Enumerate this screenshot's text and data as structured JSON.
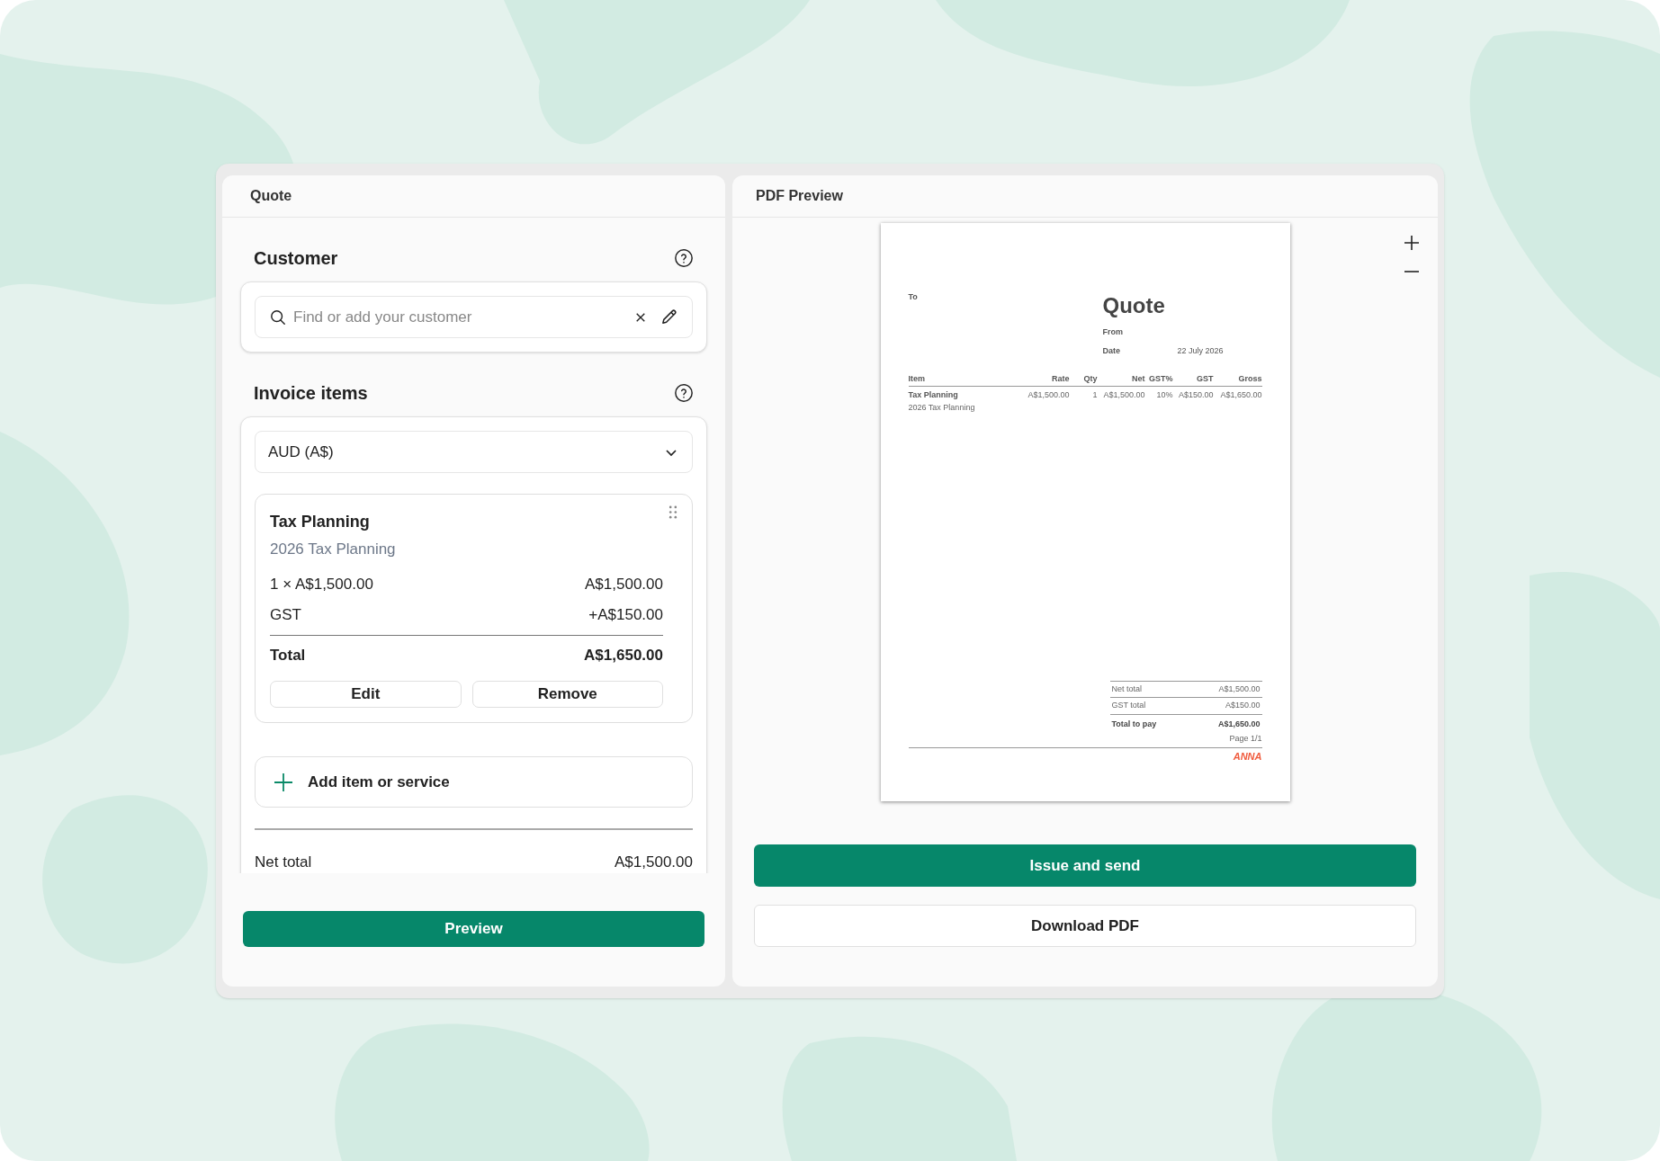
{
  "left_panel": {
    "title": "Quote",
    "customer": {
      "heading": "Customer",
      "search": {
        "placeholder": "Find or add your customer"
      }
    },
    "invoice_items": {
      "heading": "Invoice items",
      "currency": "AUD (A$)",
      "items": [
        {
          "name": "Tax Planning",
          "description": "2026 Tax Planning",
          "quantity_line": "1 × A$1,500.00",
          "net": "A$1,500.00",
          "tax_label": "GST",
          "tax": "+A$150.00",
          "total_label": "Total",
          "total": "A$1,650.00",
          "buttons": [
            "Edit",
            "Remove"
          ]
        }
      ],
      "add_button": "Add item or service",
      "net_total_label": "Net total",
      "net_total": "A$1,500.00"
    },
    "preview_button": "Preview"
  },
  "right_panel": {
    "title": "PDF Preview",
    "document": {
      "to_label": "To",
      "title": "Quote",
      "fields": [
        {
          "label": "From"
        },
        {
          "label": "Date",
          "value": "22 July 2026"
        }
      ],
      "table": {
        "columns": [
          "Item",
          "Rate",
          "Qty",
          "Net",
          "GST%",
          "GST",
          "Gross"
        ],
        "rows": [
          {
            "cells": [
              "Tax Planning",
              "A$1,500.00",
              "1",
              "A$1,500.00",
              "10%",
              "A$150.00",
              "A$1,650.00"
            ],
            "description": "2026 Tax Planning"
          }
        ]
      },
      "totals": [
        {
          "label": "Net total",
          "value": "A$1,500.00",
          "kind": "subtotal"
        },
        {
          "label": "GST total",
          "value": "A$150.00",
          "kind": "subtotal"
        },
        {
          "label": "Total to pay",
          "value": "A$1,650.00",
          "kind": "grand"
        }
      ],
      "page_label": "Page 1/1",
      "brand": "ANNA"
    },
    "buttons": [
      {
        "label": "Issue and send",
        "kind": "primary"
      },
      {
        "label": "Download PDF",
        "kind": "secondary"
      }
    ]
  }
}
